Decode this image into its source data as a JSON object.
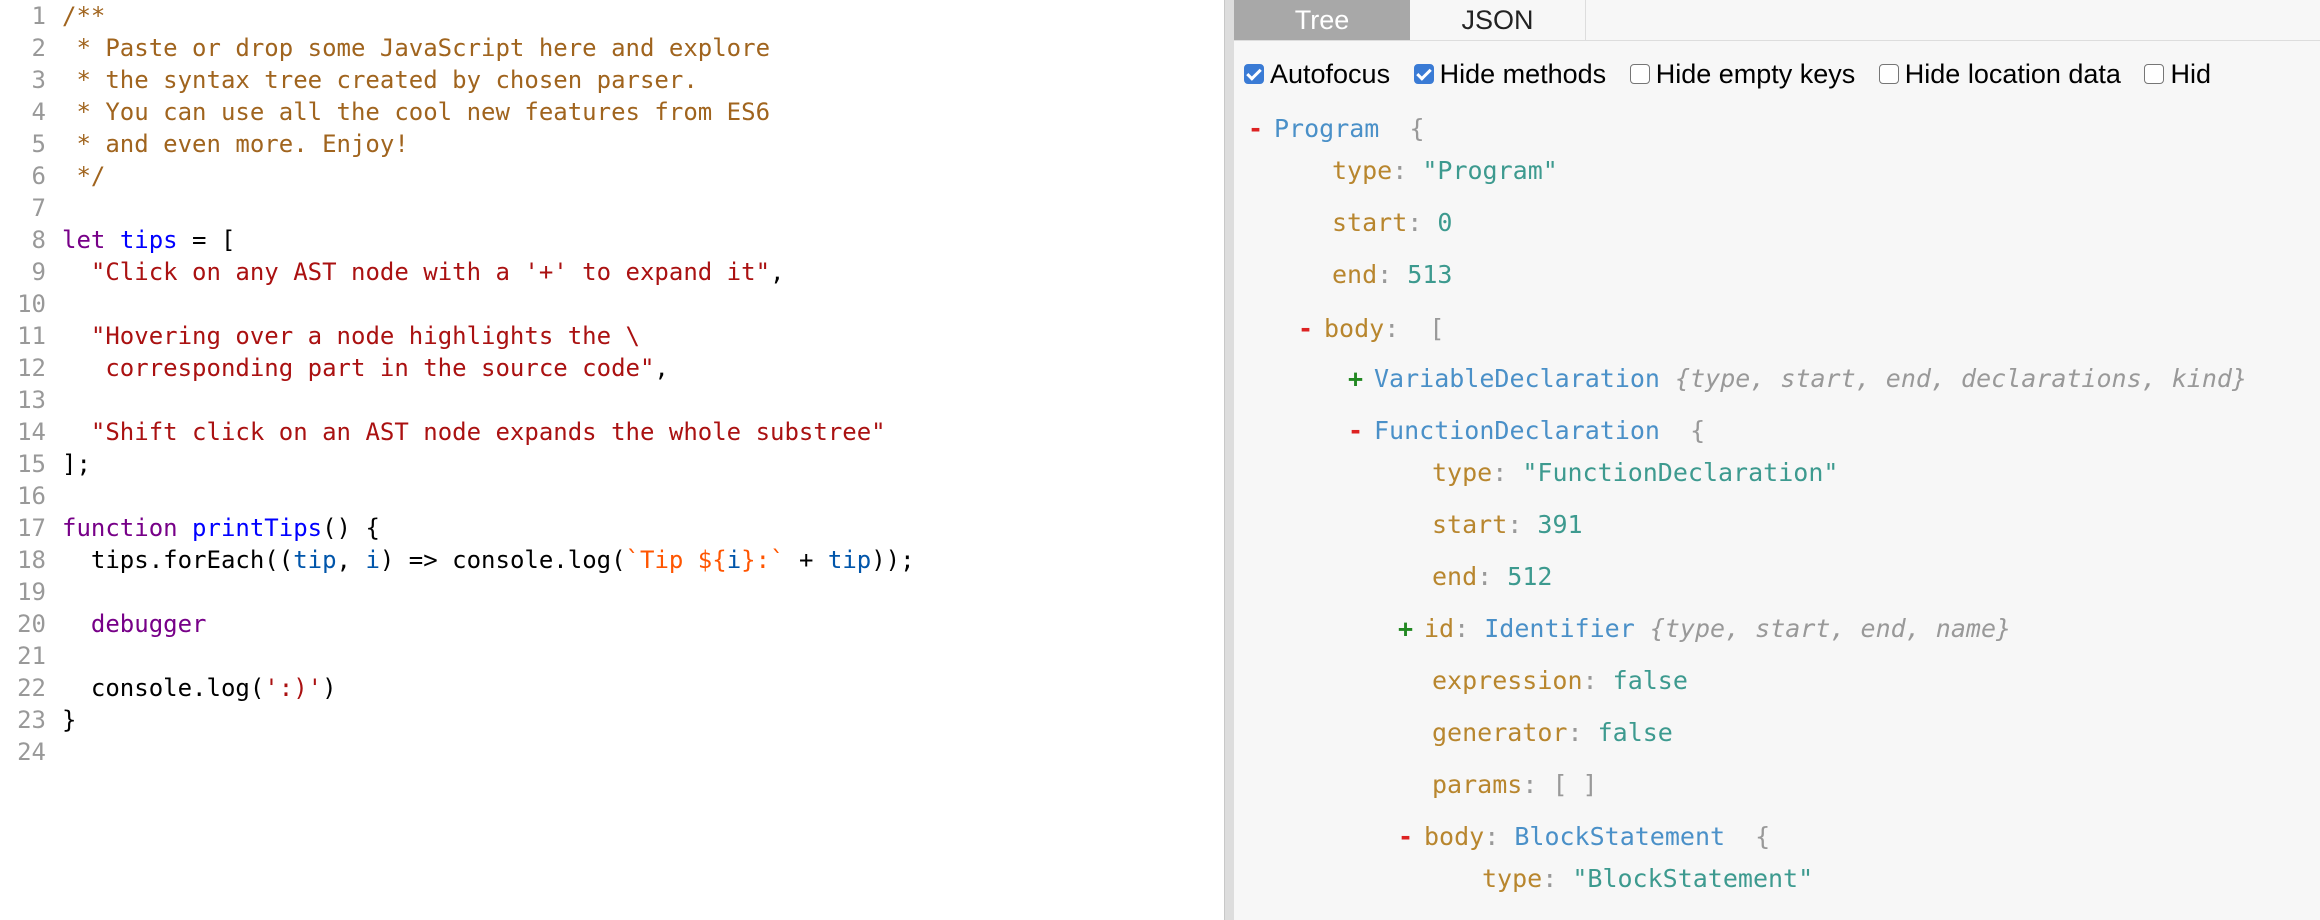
{
  "editor": {
    "line_numbers": [
      "1",
      "2",
      "3",
      "4",
      "5",
      "6",
      "7",
      "8",
      "9",
      "10",
      "11",
      "12",
      "13",
      "14",
      "15",
      "16",
      "17",
      "18",
      "19",
      "20",
      "21",
      "22",
      "23",
      "24"
    ],
    "code": {
      "l1": "/**",
      "l2": " * Paste or drop some JavaScript here and explore",
      "l3": " * the syntax tree created by chosen parser.",
      "l4": " * You can use all the cool new features from ES6",
      "l5": " * and even more. Enjoy!",
      "l6": " */",
      "l8_kw": "let",
      "l8_def": "tips",
      "l8_rest": " = [",
      "l9_ind": "  ",
      "l9_str": "\"Click on any AST node with a '+' to expand it\"",
      "l9_rest": ",",
      "l11_str": "\"Hovering over a node highlights the \\",
      "l12_str": "   corresponding part in the source code\"",
      "l12_rest": ",",
      "l14_str": "\"Shift click on an AST node expands the whole substree\"",
      "l15": "];",
      "l17_kw": "function",
      "l17_def": "printTips",
      "l17_rest": "() {",
      "l18_a": "  tips.forEach((",
      "l18_tip": "tip",
      "l18_b": ", ",
      "l18_i": "i",
      "l18_c": ") => console.log(",
      "l18_s1": "`Tip ${",
      "l18_i2": "i",
      "l18_s2": "}:`",
      "l18_d": " + ",
      "l18_tip2": "tip",
      "l18_e": "));",
      "l20_kw": "debugger",
      "l22_a": "  console.log(",
      "l22_str": "':)'",
      "l22_b": ")",
      "l23": "}"
    }
  },
  "panel": {
    "tabs": {
      "tree": "Tree",
      "json": "JSON"
    },
    "options": {
      "autofocus": "Autofocus",
      "hide_methods": "Hide methods",
      "hide_empty_keys": "Hide empty keys",
      "hide_location_data": "Hide location data",
      "hide_type_keys": "Hid"
    },
    "tree": {
      "minus": "-",
      "plus": "+",
      "colon": ":",
      "program": {
        "name": "Program",
        "brace": "{"
      },
      "type_key": "type",
      "program_type": "\"Program\"",
      "start_key": "start",
      "program_start": "0",
      "end_key": "end",
      "program_end": "513",
      "body_key": "body",
      "bracket_open": "[",
      "vardecl": {
        "name": "VariableDeclaration",
        "summary": "{type, start, end, declarations, kind}"
      },
      "funcdecl": {
        "name": "FunctionDeclaration",
        "brace": "{"
      },
      "func_type": "\"FunctionDeclaration\"",
      "func_start": "391",
      "func_end": "512",
      "id_key": "id",
      "identifier": {
        "name": "Identifier",
        "summary": "{type, start, end, name}"
      },
      "expression_key": "expression",
      "expression_val": "false",
      "generator_key": "generator",
      "generator_val": "false",
      "params_key": "params",
      "params_val": "[ ]",
      "blockstmt": {
        "name": "BlockStatement",
        "brace": "{"
      },
      "block_type": "\"BlockStatement\""
    }
  }
}
